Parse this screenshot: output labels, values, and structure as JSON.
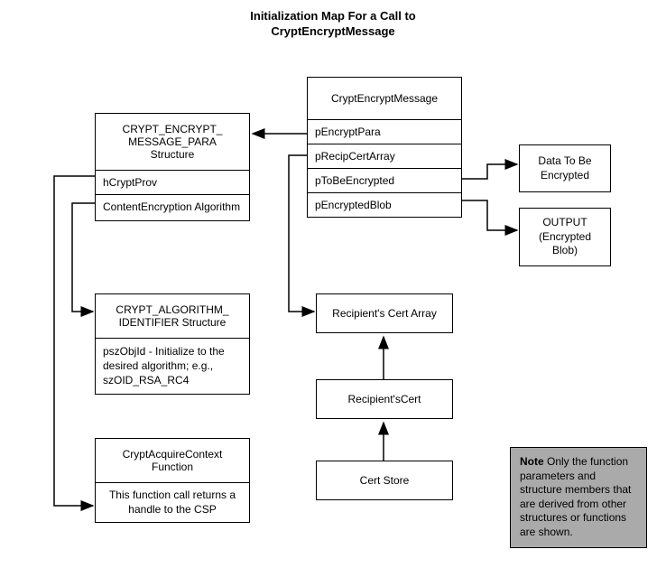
{
  "title_line1": "Initialization Map For a Call to",
  "title_line2": "CryptEncryptMessage",
  "crypt_encrypt_box": {
    "header": "CryptEncryptMessage",
    "rows": [
      "pEncryptPara",
      "pRecipCertArray",
      "pToBeEncrypted",
      "pEncryptedBlob"
    ]
  },
  "message_para_box": {
    "header_line1": "CRYPT_ENCRYPT_",
    "header_line2": "MESSAGE_PARA",
    "header_line3": "Structure",
    "rows": [
      "hCryptProv",
      "ContentEncryption Algorithm"
    ]
  },
  "algo_id_box": {
    "header_line1": "CRYPT_ALGORITHM_",
    "header_line2": "IDENTIFIER Structure",
    "body": "pszObjId - Initialize  to the desired algorithm; e.g., szOID_RSA_RC4"
  },
  "acquire_ctx_box": {
    "header_line1": "CryptAcquireContext",
    "header_line2": "Function",
    "body": "This function call returns a handle to the CSP"
  },
  "data_to_encrypt_box": {
    "line1": "Data To Be",
    "line2": "Encrypted"
  },
  "output_box": {
    "line1": "OUTPUT",
    "line2": "(Encrypted Blob)"
  },
  "recip_array_box": "Recipient's Cert Array",
  "recip_cert_box": "Recipient'sCert",
  "cert_store_box": "Cert Store",
  "note": {
    "label": "Note",
    "body": "  Only the function parameters and structure members that are derived from other structures or functions are shown."
  }
}
